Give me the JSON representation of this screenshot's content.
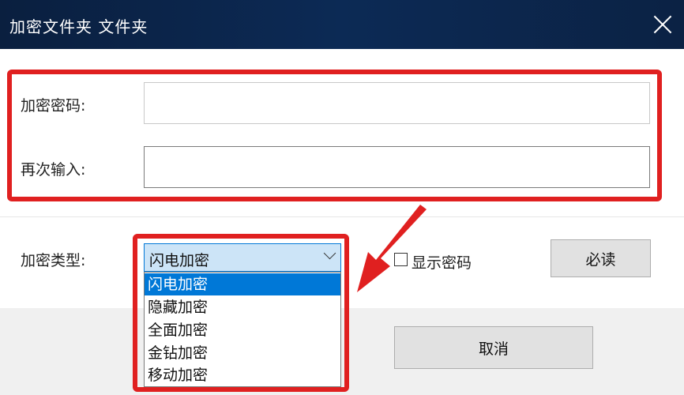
{
  "window": {
    "title": "加密文件夹 文件夹"
  },
  "form": {
    "password_label": "加密密码:",
    "password_value": "",
    "confirm_label": "再次输入:",
    "confirm_value": "",
    "type_label": "加密类型:",
    "type_selected": "闪电加密",
    "type_options": [
      "闪电加密",
      "隐藏加密",
      "全面加密",
      "金钻加密",
      "移动加密"
    ],
    "show_password_label": "显示密码",
    "show_password_checked": false
  },
  "buttons": {
    "must_read": "必读",
    "cancel": "取消"
  },
  "colors": {
    "highlight_red": "#e02020",
    "selection_blue": "#0078d7",
    "title_bar": "#0c2a55"
  },
  "icons": {
    "close": "close-icon",
    "dropdown": "chevron-down-icon",
    "annotation_arrow": "arrow-icon"
  }
}
